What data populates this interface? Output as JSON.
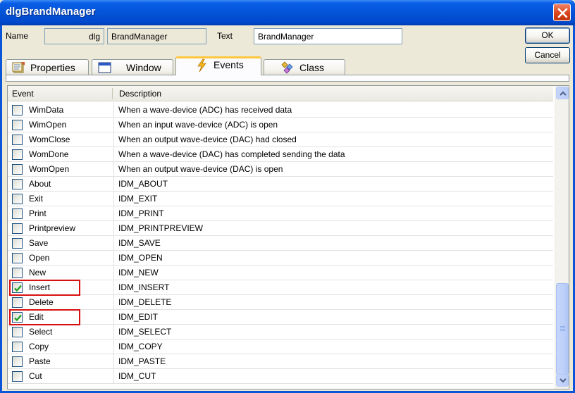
{
  "window": {
    "title": "dlgBrandManager"
  },
  "header": {
    "name_label": "Name",
    "name_prefix": "dlg",
    "name_value": "BrandManager",
    "text_label": "Text",
    "text_value": "BrandManager"
  },
  "buttons": {
    "ok": "OK",
    "cancel": "Cancel"
  },
  "tabs": [
    {
      "label": "Properties",
      "icon": "properties-icon"
    },
    {
      "label": "Window",
      "icon": "window-icon"
    },
    {
      "label": "Events",
      "icon": "lightning-icon",
      "active": true
    },
    {
      "label": "Class",
      "icon": "class-icon"
    }
  ],
  "grid": {
    "columns": [
      "Event",
      "Description"
    ],
    "rows": [
      {
        "event": "WimData",
        "description": "When a wave-device (ADC) has received data",
        "checked": false
      },
      {
        "event": "WimOpen",
        "description": "When an input wave-device (ADC) is open",
        "checked": false
      },
      {
        "event": "WomClose",
        "description": "When an output wave-device (DAC) had closed",
        "checked": false
      },
      {
        "event": "WomDone",
        "description": "When a wave-device (DAC) has completed sending the data",
        "checked": false
      },
      {
        "event": "WomOpen",
        "description": "When an output wave-device (DAC) is open",
        "checked": false
      },
      {
        "event": "About",
        "description": "IDM_ABOUT",
        "checked": false
      },
      {
        "event": "Exit",
        "description": "IDM_EXIT",
        "checked": false
      },
      {
        "event": "Print",
        "description": "IDM_PRINT",
        "checked": false
      },
      {
        "event": "Printpreview",
        "description": "IDM_PRINTPREVIEW",
        "checked": false
      },
      {
        "event": "Save",
        "description": "IDM_SAVE",
        "checked": false
      },
      {
        "event": "Open",
        "description": "IDM_OPEN",
        "checked": false
      },
      {
        "event": "New",
        "description": "IDM_NEW",
        "checked": false
      },
      {
        "event": "Insert",
        "description": "IDM_INSERT",
        "checked": true
      },
      {
        "event": "Delete",
        "description": "IDM_DELETE",
        "checked": false
      },
      {
        "event": "Edit",
        "description": "IDM_EDIT",
        "checked": true
      },
      {
        "event": "Select",
        "description": "IDM_SELECT",
        "checked": false
      },
      {
        "event": "Copy",
        "description": "IDM_COPY",
        "checked": false
      },
      {
        "event": "Paste",
        "description": "IDM_PASTE",
        "checked": false
      },
      {
        "event": "Cut",
        "description": "IDM_CUT",
        "checked": false
      }
    ]
  },
  "colors": {
    "titlebar": "#0453d7",
    "highlight": "#d81010",
    "check": "#21a121",
    "active_tab_accent": "#ffc83c"
  }
}
